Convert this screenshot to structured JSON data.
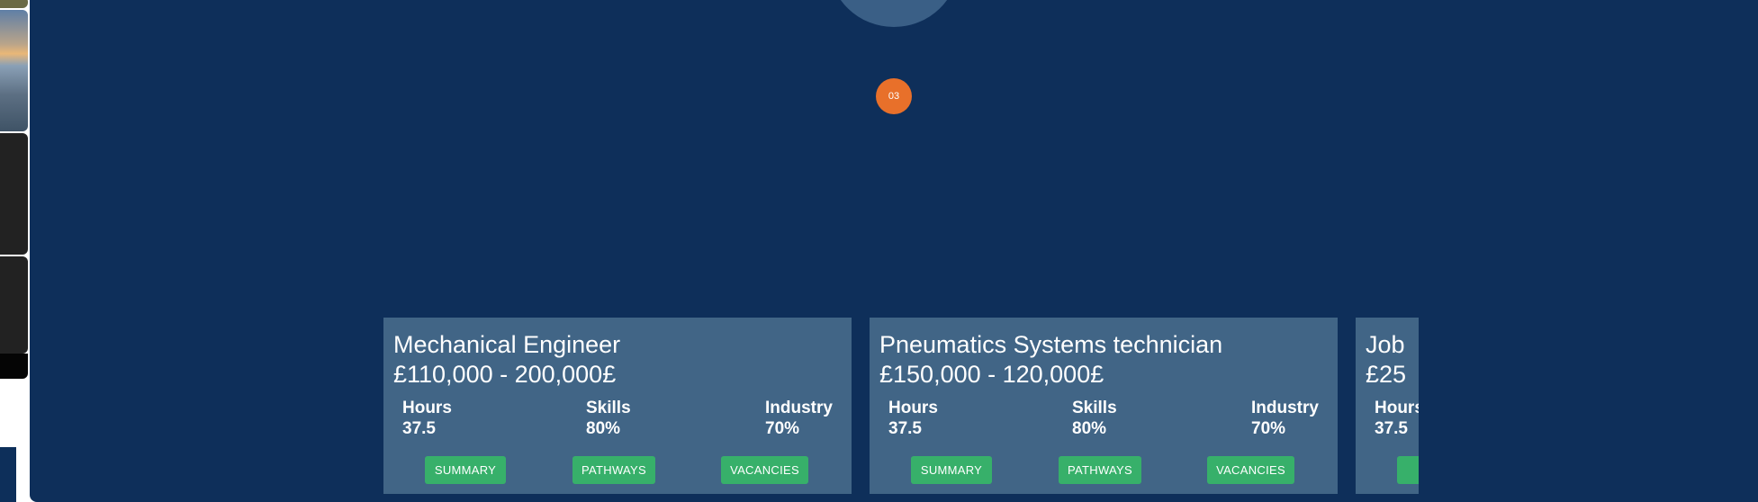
{
  "progress": {
    "step_label": "03"
  },
  "colors": {
    "background": "#0e2f5a",
    "card": "#416586",
    "button": "#37b06a",
    "badge": "#e8702a"
  },
  "cards": [
    {
      "title": "Mechanical Engineer",
      "salary": "£110,000 - 200,000£",
      "stats": [
        {
          "label": "Hours",
          "value": "37.5"
        },
        {
          "label": "Skills",
          "value": "80%"
        },
        {
          "label": "Industry",
          "value": "70%"
        }
      ],
      "buttons": {
        "summary": "SUMMARY",
        "pathways": "PATHWAYS",
        "vacancies": "VACANCIES"
      }
    },
    {
      "title": "Pneumatics Systems technician",
      "salary": "£150,000 - 120,000£",
      "stats": [
        {
          "label": "Hours",
          "value": "37.5"
        },
        {
          "label": "Skills",
          "value": "80%"
        },
        {
          "label": "Industry",
          "value": "70%"
        }
      ],
      "buttons": {
        "summary": "SUMMARY",
        "pathways": "PATHWAYS",
        "vacancies": "VACANCIES"
      }
    },
    {
      "title": "Job",
      "salary": "£25",
      "stats": [
        {
          "label": "Hours",
          "value": "37.5"
        }
      ],
      "buttons": {
        "summary": "S"
      }
    }
  ]
}
